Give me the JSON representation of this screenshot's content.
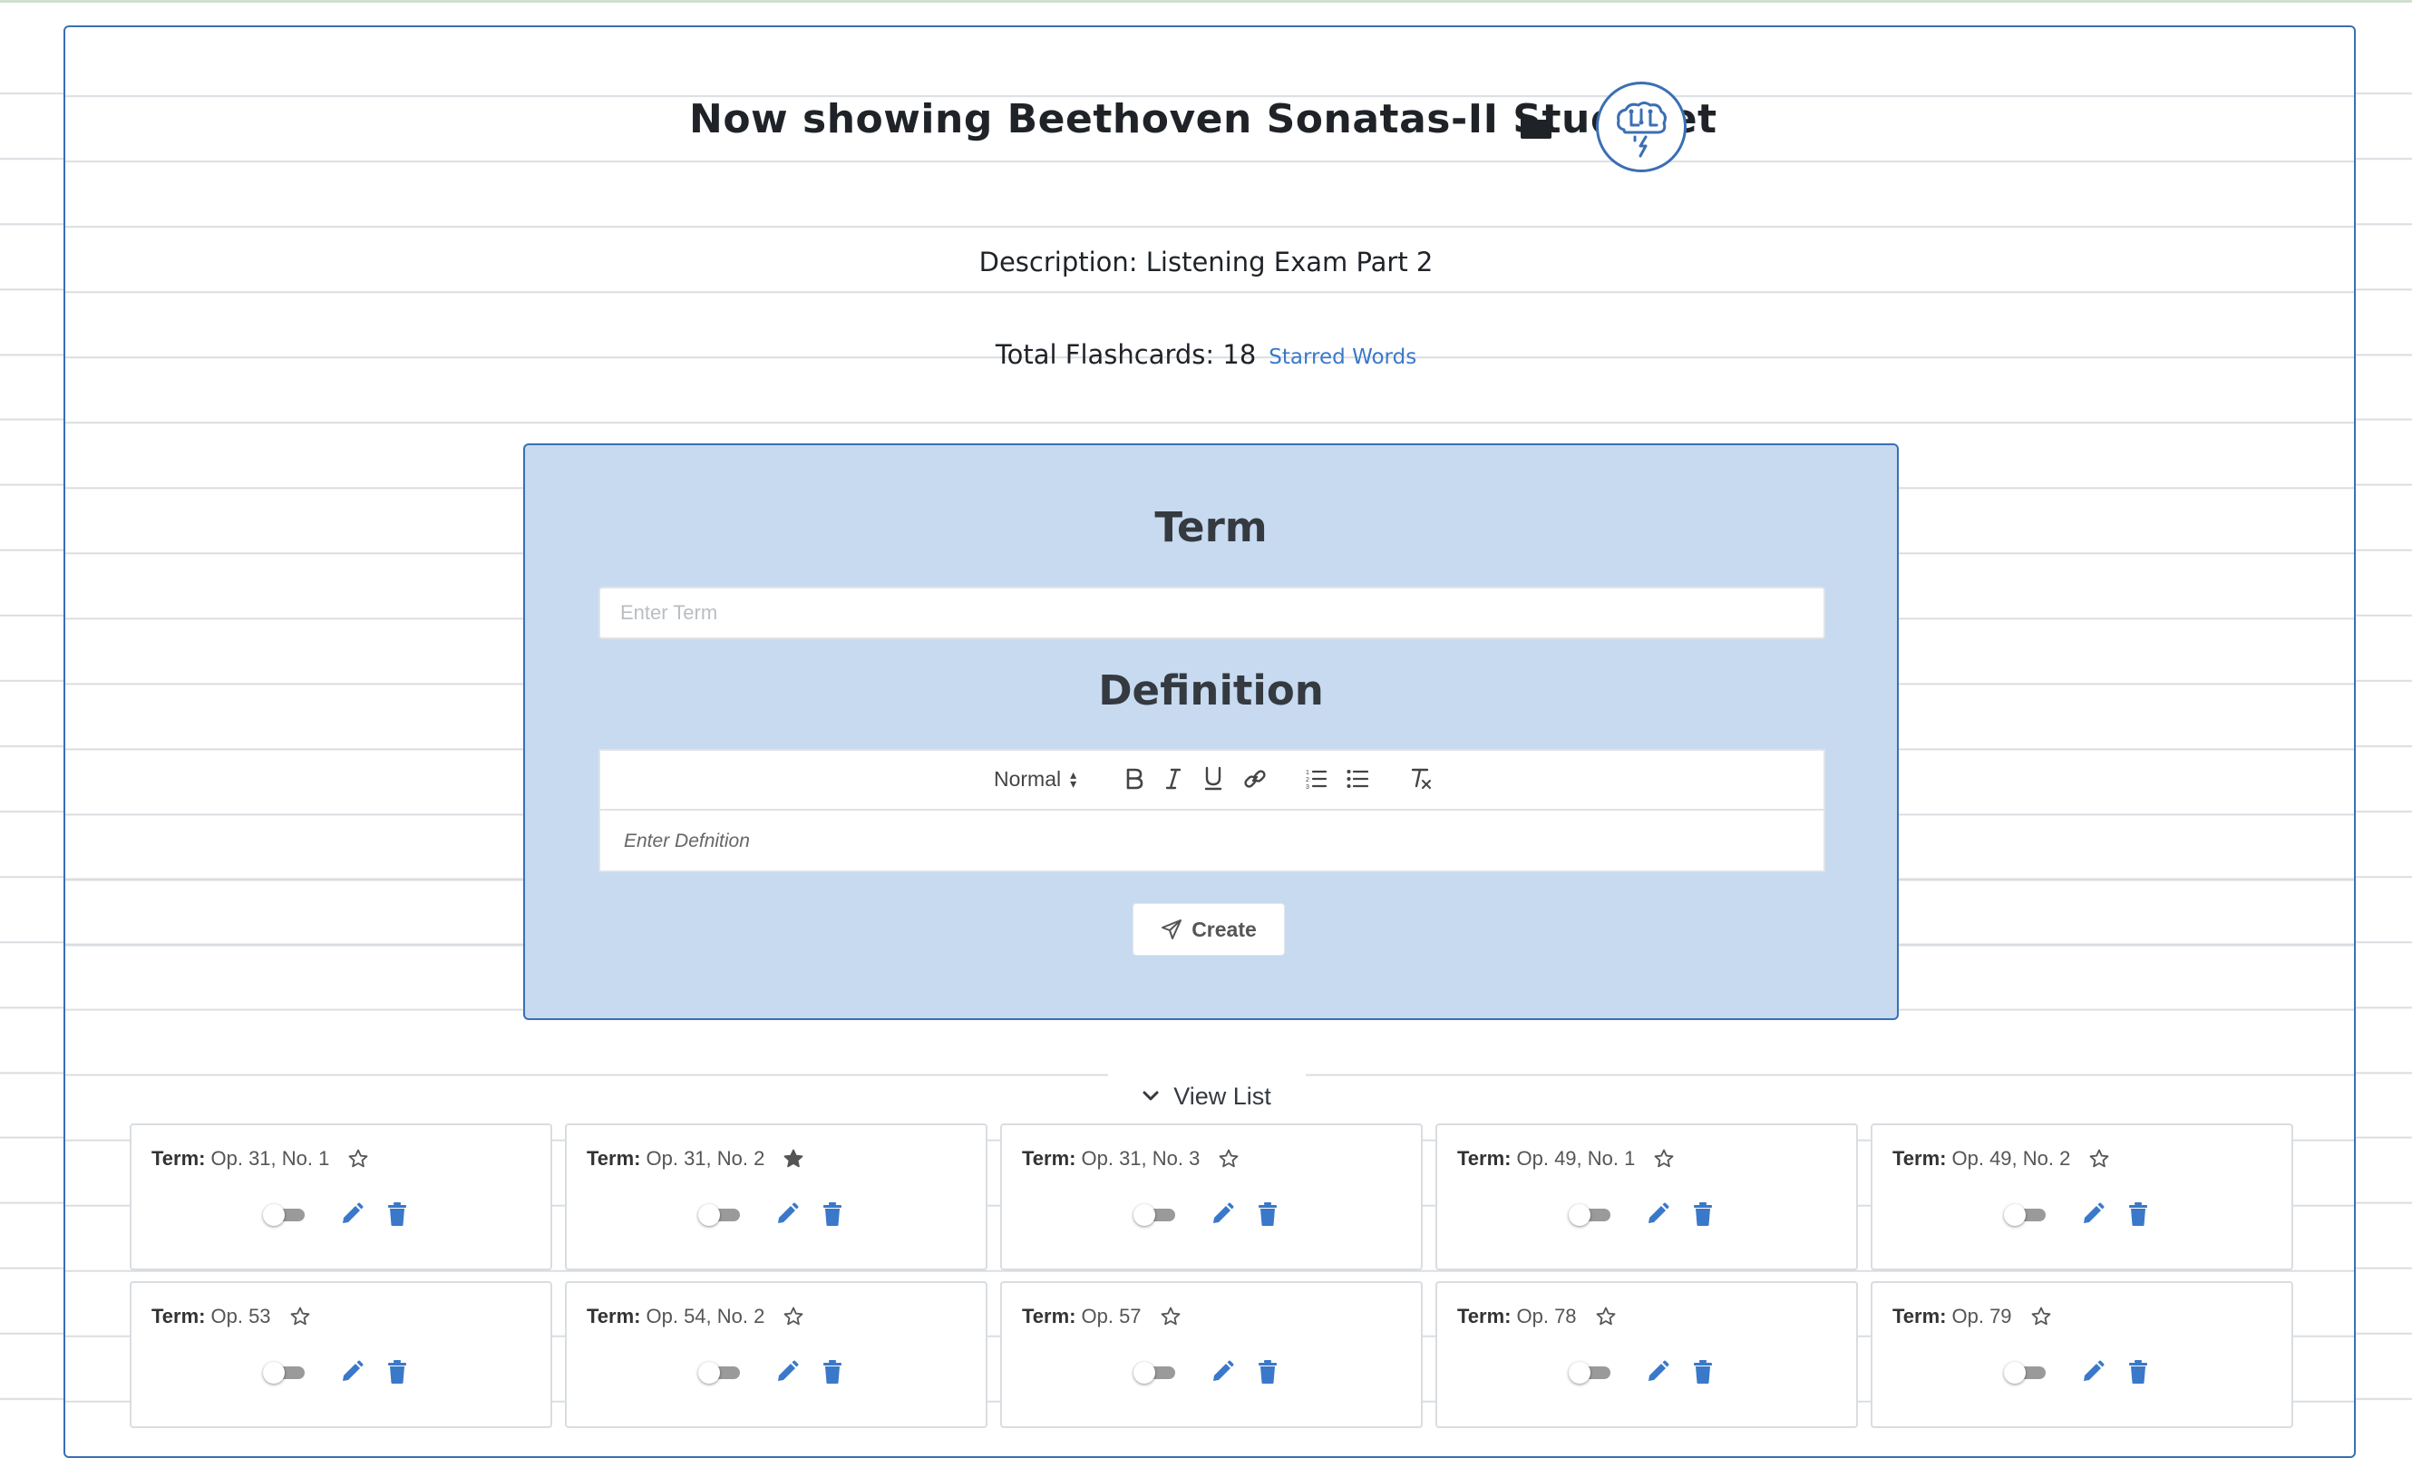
{
  "header": {
    "title": "Now showing Beethoven Sonatas-II Studyset",
    "folder_icon": "folder-icon",
    "logo_icon": "brain-circuit-icon"
  },
  "info": {
    "description": "Description: Listening Exam Part 2",
    "total_flashcards": "Total Flashcards: 18",
    "starred_link": "Starred Words"
  },
  "form": {
    "term_heading": "Term",
    "term_placeholder": "Enter Term",
    "definition_heading": "Definition",
    "toolbar": {
      "format_select": "Normal",
      "buttons": [
        "bold-icon",
        "italic-icon",
        "underline-icon",
        "link-icon",
        "ordered-list-icon",
        "bullet-list-icon",
        "clear-format-icon"
      ]
    },
    "definition_placeholder": "Enter Defnition",
    "create_label": "Create"
  },
  "view_list": {
    "label": "View List"
  },
  "cards": [
    {
      "label": "Term:",
      "term": "Op. 31, No. 1",
      "starred": false
    },
    {
      "label": "Term:",
      "term": "Op. 31, No. 2",
      "starred": true
    },
    {
      "label": "Term:",
      "term": "Op. 31, No. 3",
      "starred": false
    },
    {
      "label": "Term:",
      "term": "Op. 49, No. 1",
      "starred": false
    },
    {
      "label": "Term:",
      "term": "Op. 49, No. 2",
      "starred": false
    },
    {
      "label": "Term:",
      "term": "Op. 53",
      "starred": false
    },
    {
      "label": "Term:",
      "term": "Op. 54, No. 2",
      "starred": false
    },
    {
      "label": "Term:",
      "term": "Op. 57",
      "starred": false
    },
    {
      "label": "Term:",
      "term": "Op. 78",
      "starred": false
    },
    {
      "label": "Term:",
      "term": "Op. 79",
      "starred": false
    }
  ],
  "colors": {
    "accent": "#3a6fb5",
    "form_bg": "#c7daf0",
    "link": "#3a78c9",
    "icon_blue": "#3a78c9"
  }
}
